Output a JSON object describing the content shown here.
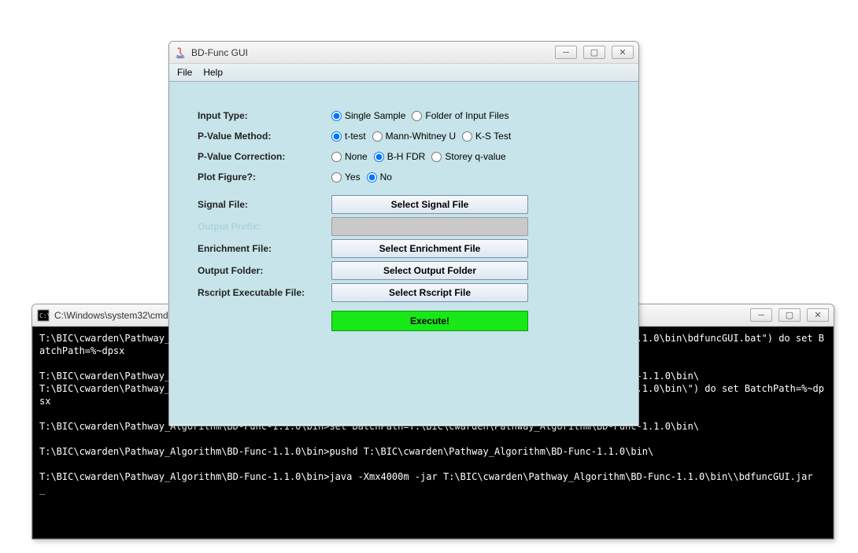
{
  "console": {
    "title": "C:\\Windows\\system32\\cmd.exe",
    "lines": [
      "T:\\BIC\\cwarden\\Pathway_Algorithm\\BD-Func-1.1.0\\bin>for %x in (\"T:\\BIC\\cwarden\\Pathway_Algorithm\\BD-Func-1.1.0\\bin\\bdfuncGUI.bat\") do set BatchPath=%~dpsx",
      "",
      "T:\\BIC\\cwarden\\Pathway_Algorithm\\BD-Func-1.1.0\\bin>set BatchPath=T:\\BIC\\cwarden\\Pathway_Algorithm\\BD-Func-1.1.0\\bin\\",
      "T:\\BIC\\cwarden\\Pathway_Algorithm\\BD-Func-1.1.0\\bin>for %x in (\"T:\\BIC\\cwarden\\Pathway_Algorithm\\BD-Func-1.1.0\\bin\\\") do set BatchPath=%~dpsx",
      "",
      "T:\\BIC\\cwarden\\Pathway_Algorithm\\BD-Func-1.1.0\\bin>set BatchPath=T:\\BIC\\cwarden\\Pathway_Algorithm\\BD-Func-1.1.0\\bin\\",
      "",
      "T:\\BIC\\cwarden\\Pathway_Algorithm\\BD-Func-1.1.0\\bin>pushd T:\\BIC\\cwarden\\Pathway_Algorithm\\BD-Func-1.1.0\\bin\\",
      "",
      "T:\\BIC\\cwarden\\Pathway_Algorithm\\BD-Func-1.1.0\\bin>java -Xmx4000m -jar T:\\BIC\\cwarden\\Pathway_Algorithm\\BD-Func-1.1.0\\bin\\\\bdfuncGUI.jar",
      "_"
    ]
  },
  "gui": {
    "title": "BD-Func GUI",
    "menu": {
      "file": "File",
      "help": "Help"
    },
    "form": {
      "input_type": {
        "label": "Input Type:",
        "opts": [
          "Single Sample",
          "Folder of Input Files"
        ],
        "selected": 0
      },
      "pvalue_method": {
        "label": "P-Value Method:",
        "opts": [
          "t-test",
          "Mann-Whitney U",
          "K-S Test"
        ],
        "selected": 0
      },
      "pvalue_correction": {
        "label": "P-Value Correction:",
        "opts": [
          "None",
          "B-H FDR",
          "Storey q-value"
        ],
        "selected": 1
      },
      "plot_figure": {
        "label": "Plot Figure?:",
        "opts": [
          "Yes",
          "No"
        ],
        "selected": 1
      },
      "signal_file": {
        "label": "Signal File:",
        "button": "Select Signal File"
      },
      "disabled_file": {
        "label": "Output Prefix:"
      },
      "enrichment_file": {
        "label": "Enrichment File:",
        "button": "Select Enrichment File"
      },
      "output_folder": {
        "label": "Output Folder:",
        "button": "Select Output Folder"
      },
      "rscript_file": {
        "label": "Rscript Executable File:",
        "button": "Select Rscript File"
      },
      "execute": "Execute!"
    }
  }
}
